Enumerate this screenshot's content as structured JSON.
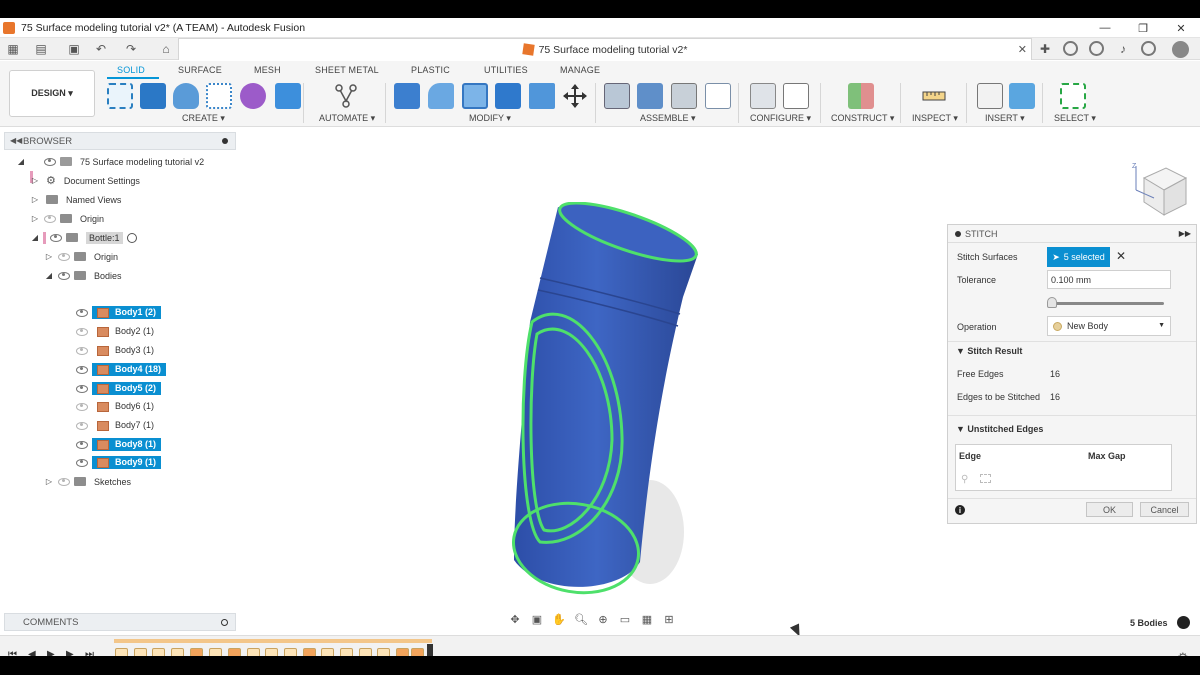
{
  "window": {
    "title": "75 Surface modeling tutorial v2* (A TEAM) - Autodesk Fusion",
    "controls": [
      "—",
      "❐",
      "✕"
    ]
  },
  "document_tab": {
    "title": "75 Surface modeling tutorial v2*"
  },
  "ribbon": {
    "workspace": "DESIGN ▾",
    "tabs": [
      "SOLID",
      "SURFACE",
      "MESH",
      "SHEET METAL",
      "PLASTIC",
      "UTILITIES",
      "MANAGE"
    ],
    "active_tab": "SOLID",
    "groups": {
      "create": "CREATE ▾",
      "automate": "AUTOMATE ▾",
      "modify": "MODIFY ▾",
      "assemble": "ASSEMBLE ▾",
      "configure": "CONFIGURE ▾",
      "construct": "CONSTRUCT ▾",
      "inspect": "INSPECT ▾",
      "insert": "INSERT ▾",
      "select": "SELECT ▾"
    }
  },
  "browser": {
    "title": "BROWSER",
    "root": "75 Surface modeling tutorial v2",
    "items": {
      "document_settings": "Document Settings",
      "named_views": "Named Views",
      "origin": "Origin",
      "bottle": "Bottle:1",
      "bottle_origin": "Origin",
      "bodies": "Bodies",
      "sketches": "Sketches"
    },
    "bodies": [
      {
        "label": "Body1 (2)",
        "selected": true
      },
      {
        "label": "Body2 (1)",
        "selected": false
      },
      {
        "label": "Body3 (1)",
        "selected": false
      },
      {
        "label": "Body4 (18)",
        "selected": true
      },
      {
        "label": "Body5 (2)",
        "selected": true
      },
      {
        "label": "Body6 (1)",
        "selected": false
      },
      {
        "label": "Body7 (1)",
        "selected": false
      },
      {
        "label": "Body8 (1)",
        "selected": true
      },
      {
        "label": "Body9 (1)",
        "selected": true
      }
    ]
  },
  "stitch_panel": {
    "title": "STITCH",
    "stitch_surfaces_label": "Stitch Surfaces",
    "selected_label": "5 selected",
    "tolerance_label": "Tolerance",
    "tolerance_value": "0.100 mm",
    "operation_label": "Operation",
    "operation_value": "New Body",
    "stitch_result_label": "Stitch Result",
    "free_edges_label": "Free Edges",
    "free_edges_value": "16",
    "edges_to_stitch_label": "Edges to be Stitched",
    "edges_to_stitch_value": "16",
    "unstitched_label": "Unstitched Edges",
    "col_edge": "Edge",
    "col_max_gap": "Max Gap",
    "ok": "OK",
    "cancel": "Cancel",
    "info": "i"
  },
  "comments": {
    "title": "COMMENTS"
  },
  "status": {
    "bodies_count": "5 Bodies"
  },
  "colors": {
    "accent": "#0696d7",
    "selection": "#0a8fd1",
    "bottle_blue": "#3a5fb8",
    "highlight_green": "#4ee06b"
  }
}
